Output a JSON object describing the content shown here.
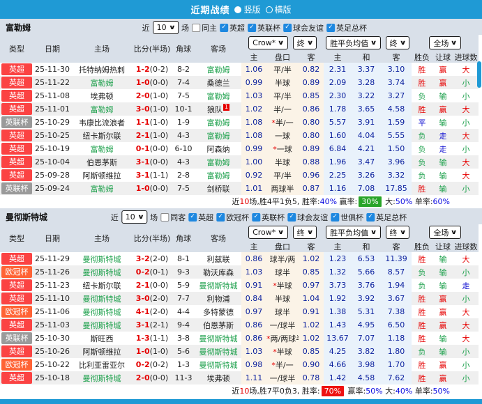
{
  "titlebar": {
    "title": "近期战绩",
    "views": [
      {
        "label": "竖版",
        "selected": true
      },
      {
        "label": "横版",
        "selected": false
      }
    ]
  },
  "filter_labels": {
    "near": "近",
    "games": "10",
    "unit": "场"
  },
  "dropdowns": {
    "company": "Crow*",
    "company_state": "终",
    "avg": "胜平负均值",
    "avg_state": "终",
    "scope": "全场"
  },
  "columns": {
    "type": "类型",
    "date": "日期",
    "home": "主场",
    "score": "比分(半场)",
    "corner": "角球",
    "away": "客场",
    "odds_home": "主",
    "odds_handicap": "盘口",
    "odds_away": "客",
    "avg_home": "主",
    "avg_draw": "和",
    "avg_away": "客",
    "result": "胜负",
    "handicap_result": "让球",
    "goals": "进球数"
  },
  "colors": {
    "accent_blue": "#1f9ad5",
    "checkbox_blue": "#1e88e0",
    "team_green": "#1ca04b",
    "score_red": "#e60000",
    "odds_navy": "#0b209e",
    "league_colors": {
      "英超": "#fb4343",
      "英联杯": "#9a9a9a",
      "欧冠杯": "#ff6335"
    },
    "outcome_colors": {
      "胜": "#e60000",
      "赢": "#e60000",
      "大": "#e60000",
      "负": "#1ca04b",
      "输": "#1ca04b",
      "小": "#1ca04b",
      "平": "#1414d2",
      "走": "#1414d2"
    }
  },
  "sections": [
    {
      "team": "富勒姆",
      "filter": {
        "same": {
          "label": "同主",
          "checked": false
        },
        "comps": [
          {
            "label": "英超",
            "checked": true
          },
          {
            "label": "英联杯",
            "checked": true
          },
          {
            "label": "球会友谊",
            "checked": true
          },
          {
            "label": "英足总杯",
            "checked": true
          }
        ]
      },
      "rows": [
        {
          "lg": "英超",
          "date": "25-11-30",
          "home": "托特纳姆热刺",
          "ht": false,
          "score": "1-2",
          "half": "(0-2)",
          "cor": "8-2",
          "away": "富勒姆",
          "at": true,
          "ab": "",
          "o1": "1.06",
          "pan": "平/半",
          "o2": "0.82",
          "m1": "2.31",
          "m2": "3.37",
          "m3": "3.10",
          "r": "胜",
          "h": "赢",
          "g": "大"
        },
        {
          "lg": "英超",
          "date": "25-11-22",
          "home": "富勒姆",
          "ht": true,
          "score": "1-0",
          "half": "(0-0)",
          "cor": "7-4",
          "away": "桑德兰",
          "at": false,
          "ab": "",
          "o1": "0.99",
          "pan": "半球",
          "o2": "0.89",
          "m1": "2.09",
          "m2": "3.28",
          "m3": "3.74",
          "r": "胜",
          "h": "赢",
          "g": "小"
        },
        {
          "lg": "英超",
          "date": "25-11-08",
          "home": "埃弗顿",
          "ht": false,
          "score": "2-0",
          "half": "(1-0)",
          "cor": "7-5",
          "away": "富勒姆",
          "at": true,
          "ab": "",
          "o1": "1.03",
          "pan": "平/半",
          "o2": "0.85",
          "m1": "2.30",
          "m2": "3.22",
          "m3": "3.27",
          "r": "负",
          "h": "输",
          "g": "小"
        },
        {
          "lg": "英超",
          "date": "25-11-01",
          "home": "富勒姆",
          "ht": true,
          "score": "3-0",
          "half": "(1-0)",
          "cor": "10-1",
          "away": "狼队",
          "at": false,
          "ab": "1",
          "o1": "1.02",
          "pan": "半/一",
          "o2": "0.86",
          "m1": "1.78",
          "m2": "3.65",
          "m3": "4.58",
          "r": "胜",
          "h": "赢",
          "g": "大"
        },
        {
          "lg": "英联杯",
          "date": "25-10-29",
          "home": "韦康比流浪者",
          "ht": false,
          "score": "1-1",
          "half": "(1-0)",
          "cor": "1-9",
          "away": "富勒姆",
          "at": true,
          "ab": "",
          "o1": "1.08",
          "pan": "*半/一",
          "o2": "0.80",
          "m1": "5.57",
          "m2": "3.91",
          "m3": "1.59",
          "r": "平",
          "h": "输",
          "g": "小"
        },
        {
          "lg": "英超",
          "date": "25-10-25",
          "home": "纽卡斯尔联",
          "ht": false,
          "score": "2-1",
          "half": "(1-0)",
          "cor": "4-3",
          "away": "富勒姆",
          "at": true,
          "ab": "",
          "o1": "1.08",
          "pan": "一球",
          "o2": "0.80",
          "m1": "1.60",
          "m2": "4.04",
          "m3": "5.55",
          "r": "负",
          "h": "走",
          "g": "大"
        },
        {
          "lg": "英超",
          "date": "25-10-19",
          "home": "富勒姆",
          "ht": true,
          "score": "0-1",
          "half": "(0-0)",
          "cor": "6-10",
          "away": "阿森纳",
          "at": false,
          "ab": "",
          "o1": "0.99",
          "pan": "*一球",
          "o2": "0.89",
          "m1": "6.84",
          "m2": "4.21",
          "m3": "1.50",
          "r": "负",
          "h": "走",
          "g": "小"
        },
        {
          "lg": "英超",
          "date": "25-10-04",
          "home": "伯恩茅斯",
          "ht": false,
          "score": "3-1",
          "half": "(0-0)",
          "cor": "4-3",
          "away": "富勒姆",
          "at": true,
          "ab": "",
          "o1": "1.00",
          "pan": "半球",
          "o2": "0.88",
          "m1": "1.96",
          "m2": "3.47",
          "m3": "3.96",
          "r": "负",
          "h": "输",
          "g": "大"
        },
        {
          "lg": "英超",
          "date": "25-09-28",
          "home": "阿斯顿维拉",
          "ht": false,
          "score": "3-1",
          "half": "(1-1)",
          "cor": "2-8",
          "away": "富勒姆",
          "at": true,
          "ab": "",
          "o1": "0.92",
          "pan": "平/半",
          "o2": "0.96",
          "m1": "2.25",
          "m2": "3.26",
          "m3": "3.32",
          "r": "负",
          "h": "输",
          "g": "大"
        },
        {
          "lg": "英联杯",
          "date": "25-09-24",
          "home": "富勒姆",
          "ht": true,
          "score": "1-0",
          "half": "(0-0)",
          "cor": "7-5",
          "away": "剑桥联",
          "at": false,
          "ab": "",
          "o1": "1.01",
          "pan": "两球半",
          "o2": "0.87",
          "m1": "1.16",
          "m2": "7.08",
          "m3": "17.85",
          "r": "胜",
          "h": "输",
          "g": "小"
        }
      ],
      "summary": [
        {
          "t": "近",
          "s": "p"
        },
        {
          "t": "10",
          "s": "r"
        },
        {
          "t": "场,胜4平1负5, 胜率:",
          "s": "p"
        },
        {
          "t": "40%",
          "s": "b"
        },
        {
          "t": " 赢率:",
          "s": "p"
        },
        {
          "t": "30%",
          "s": "bg"
        },
        {
          "t": " 大:",
          "s": "p"
        },
        {
          "t": "50%",
          "s": "b"
        },
        {
          "t": " 单率:",
          "s": "p"
        },
        {
          "t": "60%",
          "s": "b"
        }
      ]
    },
    {
      "team": "曼彻斯特城",
      "filter": {
        "same": {
          "label": "同客",
          "checked": false
        },
        "comps": [
          {
            "label": "英超",
            "checked": true
          },
          {
            "label": "欧冠杯",
            "checked": true
          },
          {
            "label": "英联杯",
            "checked": true
          },
          {
            "label": "球会友谊",
            "checked": true
          },
          {
            "label": "世俱杯",
            "checked": true
          },
          {
            "label": "英足总杯",
            "checked": true
          }
        ]
      },
      "rows": [
        {
          "lg": "英超",
          "date": "25-11-29",
          "home": "曼彻斯特城",
          "ht": true,
          "score": "3-2",
          "half": "(2-0)",
          "cor": "8-1",
          "away": "利兹联",
          "at": false,
          "ab": "",
          "o1": "0.86",
          "pan": "球半/两",
          "o2": "1.02",
          "m1": "1.23",
          "m2": "6.53",
          "m3": "11.39",
          "r": "胜",
          "h": "输",
          "g": "大"
        },
        {
          "lg": "欧冠杯",
          "date": "25-11-26",
          "home": "曼彻斯特城",
          "ht": true,
          "score": "0-2",
          "half": "(0-1)",
          "cor": "9-3",
          "away": "勒沃库森",
          "at": false,
          "ab": "",
          "o1": "1.03",
          "pan": "球半",
          "o2": "0.85",
          "m1": "1.32",
          "m2": "5.66",
          "m3": "8.57",
          "r": "负",
          "h": "输",
          "g": "小"
        },
        {
          "lg": "英超",
          "date": "25-11-23",
          "home": "纽卡斯尔联",
          "ht": false,
          "score": "2-1",
          "half": "(0-0)",
          "cor": "5-9",
          "away": "曼彻斯特城",
          "at": true,
          "ab": "",
          "o1": "0.91",
          "pan": "*半球",
          "o2": "0.97",
          "m1": "3.73",
          "m2": "3.76",
          "m3": "1.94",
          "r": "负",
          "h": "输",
          "g": "走"
        },
        {
          "lg": "英超",
          "date": "25-11-10",
          "home": "曼彻斯特城",
          "ht": true,
          "score": "3-0",
          "half": "(2-0)",
          "cor": "7-7",
          "away": "利物浦",
          "at": false,
          "ab": "",
          "o1": "0.84",
          "pan": "半球",
          "o2": "1.04",
          "m1": "1.92",
          "m2": "3.92",
          "m3": "3.67",
          "r": "胜",
          "h": "赢",
          "g": "小"
        },
        {
          "lg": "欧冠杯",
          "date": "25-11-06",
          "home": "曼彻斯特城",
          "ht": true,
          "score": "4-1",
          "half": "(2-0)",
          "cor": "4-4",
          "away": "多特蒙德",
          "at": false,
          "ab": "",
          "o1": "0.97",
          "pan": "球半",
          "o2": "0.91",
          "m1": "1.38",
          "m2": "5.31",
          "m3": "7.38",
          "r": "胜",
          "h": "赢",
          "g": "大"
        },
        {
          "lg": "英超",
          "date": "25-11-03",
          "home": "曼彻斯特城",
          "ht": true,
          "score": "3-1",
          "half": "(2-1)",
          "cor": "9-4",
          "away": "伯恩茅斯",
          "at": false,
          "ab": "",
          "o1": "0.86",
          "pan": "一/球半",
          "o2": "1.02",
          "m1": "1.43",
          "m2": "4.95",
          "m3": "6.50",
          "r": "胜",
          "h": "赢",
          "g": "大"
        },
        {
          "lg": "英联杯",
          "date": "25-10-30",
          "home": "斯旺西",
          "ht": false,
          "score": "1-3",
          "half": "(1-1)",
          "cor": "3-8",
          "away": "曼彻斯特城",
          "at": true,
          "ab": "",
          "o1": "0.86",
          "pan": "*两/两球半",
          "o2": "1.02",
          "m1": "13.67",
          "m2": "7.07",
          "m3": "1.18",
          "r": "胜",
          "h": "输",
          "g": "大"
        },
        {
          "lg": "英超",
          "date": "25-10-26",
          "home": "阿斯顿维拉",
          "ht": false,
          "score": "1-0",
          "half": "(1-0)",
          "cor": "5-6",
          "away": "曼彻斯特城",
          "at": true,
          "ab": "",
          "o1": "1.03",
          "pan": "*半球",
          "o2": "0.85",
          "m1": "4.25",
          "m2": "3.82",
          "m3": "1.80",
          "r": "负",
          "h": "输",
          "g": "小"
        },
        {
          "lg": "欧冠杯",
          "date": "25-10-22",
          "home": "比利亚雷亚尔",
          "ht": false,
          "score": "0-2",
          "half": "(0-2)",
          "cor": "1-3",
          "away": "曼彻斯特城",
          "at": true,
          "ab": "",
          "o1": "0.98",
          "pan": "*半/一",
          "o2": "0.90",
          "m1": "4.66",
          "m2": "3.98",
          "m3": "1.70",
          "r": "胜",
          "h": "赢",
          "g": "小"
        },
        {
          "lg": "英超",
          "date": "25-10-18",
          "home": "曼彻斯特城",
          "ht": true,
          "score": "2-0",
          "half": "(0-0)",
          "cor": "11-3",
          "away": "埃弗顿",
          "at": false,
          "ab": "",
          "o1": "1.11",
          "pan": "一/球半",
          "o2": "0.78",
          "m1": "1.42",
          "m2": "4.58",
          "m3": "7.62",
          "r": "胜",
          "h": "赢",
          "g": "小"
        }
      ],
      "summary": [
        {
          "t": "近",
          "s": "p"
        },
        {
          "t": "10",
          "s": "r"
        },
        {
          "t": "场,胜7平0负3, 胜率:",
          "s": "p"
        },
        {
          "t": "70%",
          "s": "br"
        },
        {
          "t": " 赢率:",
          "s": "p"
        },
        {
          "t": "50%",
          "s": "b"
        },
        {
          "t": " 大:",
          "s": "p"
        },
        {
          "t": "40%",
          "s": "b"
        },
        {
          "t": " 单率:",
          "s": "p"
        },
        {
          "t": "50%",
          "s": "b"
        }
      ]
    }
  ]
}
